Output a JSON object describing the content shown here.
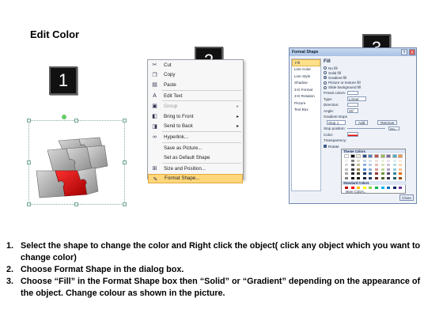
{
  "title": "Edit Color",
  "steps": [
    "1",
    "2",
    "3"
  ],
  "context_menu": {
    "items": [
      {
        "label": "Cut",
        "icon": "scissors-icon",
        "glyph": "✂"
      },
      {
        "label": "Copy",
        "icon": "copy-icon",
        "glyph": "❐"
      },
      {
        "label": "Paste",
        "icon": "paste-icon",
        "glyph": "▤"
      },
      {
        "label": "Edit Text",
        "icon": "edit-text-icon",
        "glyph": "A"
      },
      {
        "label": "Group",
        "icon": "group-icon",
        "glyph": "▣",
        "disabled": true,
        "submenu": true
      },
      {
        "label": "Bring to Front",
        "icon": "bring-front-icon",
        "glyph": "◧",
        "submenu": true
      },
      {
        "label": "Send to Back",
        "icon": "send-back-icon",
        "glyph": "◨",
        "submenu": true
      },
      {
        "label": "Hyperlink...",
        "icon": "hyperlink-icon",
        "glyph": "∞"
      },
      {
        "label": "Save as Picture...",
        "icon": "",
        "glyph": ""
      },
      {
        "label": "Set as Default Shape",
        "icon": "",
        "glyph": ""
      },
      {
        "label": "Size and Position...",
        "icon": "size-icon",
        "glyph": "⊞"
      },
      {
        "label": "Format Shape...",
        "icon": "format-shape-icon",
        "glyph": "✎",
        "highlighted": true
      }
    ]
  },
  "format_dialog": {
    "title": "Format Shape",
    "help": "?",
    "close": "X",
    "categories": [
      "Fill",
      "Line Color",
      "Line Style",
      "Shadow",
      "3-D Format",
      "3-D Rotation",
      "Picture",
      "Text Box"
    ],
    "fill_heading": "Fill",
    "fill_options": [
      {
        "label": "No fill",
        "selected": false
      },
      {
        "label": "Solid fill",
        "selected": false
      },
      {
        "label": "Gradient fill",
        "selected": true
      },
      {
        "label": "Picture or texture fill",
        "selected": false
      },
      {
        "label": "Slide background fill",
        "selected": false
      }
    ],
    "preset_colors": "Preset colors:",
    "type_label": "Type:",
    "type_value": "Linear",
    "direction_label": "Direction:",
    "angle_label": "Angle:",
    "angle_value": "45°",
    "gradient_stops": "Gradient stops",
    "stop_value": "Stop 1",
    "add_button": "Add",
    "remove_button": "Remove",
    "stop_position_label": "Stop position:",
    "stop_position_value": "0%",
    "color_label": "Color:",
    "transparency_label": "Transparency:",
    "rotate_label": "Rotate",
    "close_button": "Close"
  },
  "color_picker": {
    "theme_heading": "Theme Colors",
    "standard_heading": "Standard Colors",
    "more_colors": "More Colors...",
    "theme_columns": [
      "#ffffff",
      "#000000",
      "#eeece1",
      "#1f497d",
      "#4f81bd",
      "#c0504d",
      "#9bbb59",
      "#8064a2",
      "#4bacc6",
      "#f79646"
    ],
    "theme_shades": [
      [
        "#f2f2f2",
        "#7f7f7f",
        "#ddd9c3",
        "#c6d9f0",
        "#dbe5f1",
        "#f2dcdb",
        "#ebf1dd",
        "#e5e0ec",
        "#dbeef3",
        "#fdeada"
      ],
      [
        "#d8d8d8",
        "#595959",
        "#c4bd97",
        "#8db3e2",
        "#b8cce4",
        "#e5b9b7",
        "#d7e3bc",
        "#ccc1d9",
        "#b7dde8",
        "#fbd5b5"
      ],
      [
        "#bfbfbf",
        "#3f3f3f",
        "#938953",
        "#548dd4",
        "#95b3d7",
        "#d99694",
        "#c3d69b",
        "#b2a2c7",
        "#92cddc",
        "#fac08f"
      ],
      [
        "#a5a5a5",
        "#262626",
        "#494429",
        "#17365d",
        "#366092",
        "#953734",
        "#76923c",
        "#5f497a",
        "#31859b",
        "#e36c09"
      ],
      [
        "#7f7f7f",
        "#0c0c0c",
        "#1d1b10",
        "#0f243e",
        "#244061",
        "#632423",
        "#4f6128",
        "#3f3151",
        "#205867",
        "#974806"
      ]
    ],
    "standard_colors": [
      "#c00000",
      "#ff0000",
      "#ffc000",
      "#ffff00",
      "#92d050",
      "#00b050",
      "#00b0f0",
      "#0070c0",
      "#002060",
      "#7030a0"
    ]
  },
  "instructions": [
    {
      "num": "1.",
      "text": "Select the shape to change the color and Right click the object( click any object which you want to change color)"
    },
    {
      "num": "2.",
      "text": "Choose Format Shape in the dialog box."
    },
    {
      "num": "3.",
      "text": "Choose “Fill” in the Format Shape box then “Solid” or “Gradient” depending on the appearance of the object. Change colour as shown in the picture."
    }
  ]
}
